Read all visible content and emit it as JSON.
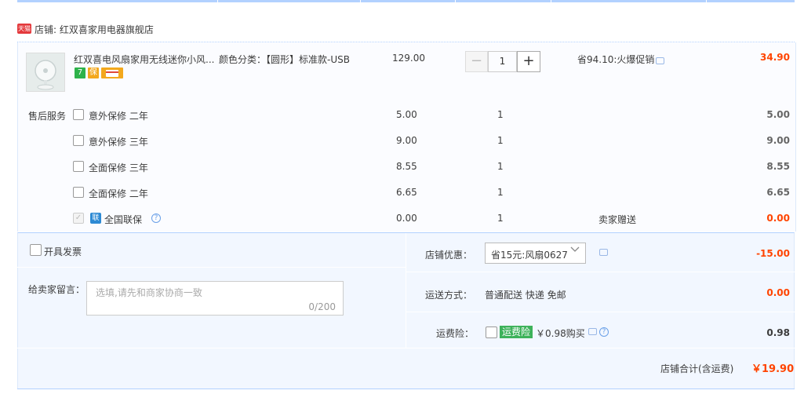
{
  "shop": {
    "badge": "天猫",
    "name": "店铺: 红双喜家用电器旗舰店"
  },
  "product": {
    "title": "红双喜电风扇家用无线迷你小风...",
    "attributes": "颜色分类：【圆形】标准款-USB",
    "price": "129.00",
    "quantity": "1",
    "promo": "省94.10:火爆促销",
    "total": "34.90",
    "badges": [
      "7",
      "保",
      "券"
    ]
  },
  "services": {
    "label": "售后服务",
    "rows": [
      {
        "name": "意外保修 二年",
        "price": "5.00",
        "qty": "1",
        "note": "",
        "total": "5.00",
        "checked": false,
        "disabled": false
      },
      {
        "name": "意外保修 三年",
        "price": "9.00",
        "qty": "1",
        "note": "",
        "total": "9.00",
        "checked": false,
        "disabled": false
      },
      {
        "name": "全面保修 三年",
        "price": "8.55",
        "qty": "1",
        "note": "",
        "total": "8.55",
        "checked": false,
        "disabled": false
      },
      {
        "name": "全面保修 二年",
        "price": "6.65",
        "qty": "1",
        "note": "",
        "total": "6.65",
        "checked": false,
        "disabled": false
      },
      {
        "name": "全国联保",
        "price": "0.00",
        "qty": "1",
        "note": "卖家赠送",
        "total": "0.00",
        "checked": true,
        "disabled": true,
        "icon": "联"
      }
    ]
  },
  "invoice": {
    "label": "开具发票"
  },
  "message": {
    "label": "给卖家留言：",
    "placeholder": "选填,请先和商家协商一致",
    "count": "0/200"
  },
  "coupon": {
    "label": "店铺优惠：",
    "selected": "省15元:风扇0627",
    "amount": "-15.00"
  },
  "shipping": {
    "label": "运送方式：",
    "value": "普通配送 快递 免邮",
    "amount": "0.00"
  },
  "insurance": {
    "label": "运费险：",
    "badge": "运费险",
    "price": "￥0.98购买",
    "amount": "0.98"
  },
  "summary": {
    "label": "店铺合计(含运费)",
    "value": "￥19.90"
  },
  "colors": {
    "accent_red": "#ff4400",
    "border_blue": "#b2d1ff",
    "footer_bg": "#f2f7ff",
    "insurance_green": "#3db25a"
  }
}
